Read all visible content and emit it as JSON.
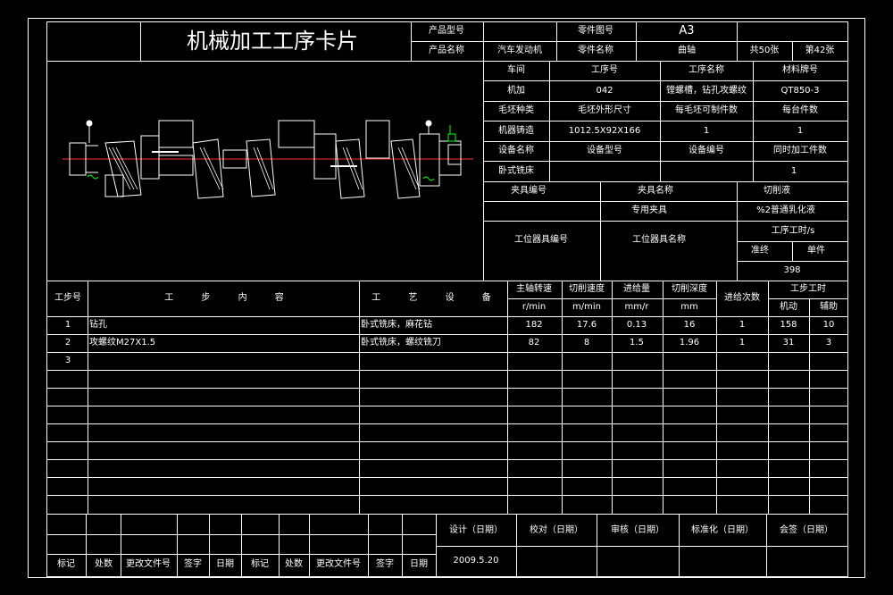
{
  "header": {
    "title": "机械加工工序卡片",
    "product_model_label": "产品型号",
    "product_model_value": "",
    "part_drawing_label": "零件图号",
    "part_drawing_value": "A3",
    "product_name_label": "产品名称",
    "product_name_value": "汽车发动机",
    "part_name_label": "零件名称",
    "part_name_value": "曲轴",
    "total_sheets": "共50张",
    "sheet_no": "第42张"
  },
  "info": {
    "workshop_label": "车间",
    "process_no_label": "工序号",
    "process_name_label": "工序名称",
    "material_label": "材料牌号",
    "workshop_value": "机加",
    "process_no_value": "042",
    "process_name_value": "镗螺槽，钻孔攻螺纹",
    "material_value": "QT850-3",
    "blank_type_label": "毛坯种类",
    "blank_size_label": "毛坯外形尺寸",
    "parts_per_blank_label": "每毛坯可制件数",
    "parts_per_unit_label": "每台件数",
    "blank_type_value": "机器铸造",
    "blank_size_value": "1012.5X92X166",
    "parts_per_blank_value": "1",
    "parts_per_unit_value": "1",
    "equipment_name_label": "设备名称",
    "equipment_model_label": "设备型号",
    "equipment_no_label": "设备编号",
    "simultaneous_label": "同时加工件数",
    "equipment_name_value": "卧式铣床",
    "equipment_model_value": "",
    "equipment_no_value": "",
    "simultaneous_value": "1",
    "fixture_no_label": "夹具编号",
    "fixture_name_label": "夹具名称",
    "coolant_label": "切削液",
    "fixture_no_value": "",
    "fixture_name_value": "专用夹具",
    "coolant_value": "%2普通乳化液",
    "station_tool_no_label": "工位器具编号",
    "station_tool_name_label": "工位器具名称",
    "process_time_label": "工序工时/s",
    "prep_end_label": "准终",
    "unit_label": "单件",
    "unit_value": "398"
  },
  "steps_header": {
    "step_no": "工步号",
    "content": "工 步 内 容",
    "equipment": "工 艺 设 备",
    "spindle_speed": "主轴转速",
    "spindle_unit": "r/min",
    "cutting_speed": "切削速度",
    "cutting_unit": "m/min",
    "feed": "进给量",
    "feed_unit": "mm/r",
    "depth": "切削深度",
    "depth_unit": "mm",
    "passes": "进给次数",
    "step_time": "工步工时",
    "machine_time": "机动",
    "aux_time": "辅助"
  },
  "steps": [
    {
      "no": "1",
      "content": "钻孔",
      "equipment": "卧式铣床，麻花钻",
      "spindle": "182",
      "cutting": "17.6",
      "feed": "0.13",
      "depth": "16",
      "passes": "1",
      "machine": "158",
      "aux": "10"
    },
    {
      "no": "2",
      "content": "攻螺纹M27X1.5",
      "equipment": "卧式铣床，螺纹铣刀",
      "spindle": "82",
      "cutting": "8",
      "feed": "1.5",
      "depth": "1.96",
      "passes": "1",
      "machine": "31",
      "aux": "3"
    },
    {
      "no": "3",
      "content": "",
      "equipment": "",
      "spindle": "",
      "cutting": "",
      "feed": "",
      "depth": "",
      "passes": "",
      "machine": "",
      "aux": ""
    }
  ],
  "footer": {
    "design": "设计（日期）",
    "proofread": "校对（日期）",
    "review": "审核（日期）",
    "standardize": "标准化（日期）",
    "countersign": "会签（日期）",
    "design_date": "2009.5.20",
    "mark": "标记",
    "count": "处数",
    "change_doc": "更改文件号",
    "signature": "签字",
    "date": "日期",
    "mark2": "标记",
    "count2": "处数",
    "change_doc2": "更改文件号",
    "signature2": "签字",
    "date2": "日期"
  },
  "colors": {
    "background": "#000000",
    "line": "#ffffff",
    "centerline": "#ff0000",
    "symbol": "#00ff00"
  }
}
